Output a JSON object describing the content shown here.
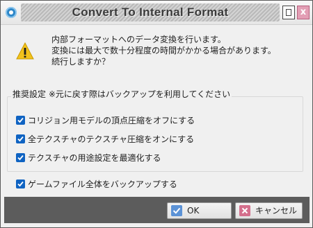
{
  "window": {
    "title": "Convert To Internal Format",
    "close_glyph": "x"
  },
  "message": {
    "icon": "warning-icon",
    "lines": [
      "内部フォーマットへのデータ変換を行います。",
      "変換には最大で数十分程度の時間がかかる場合があります。",
      "続行しますか？"
    ]
  },
  "recommended": {
    "legend": "推奨設定 ※元に戻す際はバックアップを利用してください",
    "options": [
      {
        "label": "コリジョン用モデルの頂点圧縮をオフにする",
        "checked": true
      },
      {
        "label": "全テクスチャのテクスチャ圧縮をオンにする",
        "checked": true
      },
      {
        "label": "テクスチャの用途設定を最適化する",
        "checked": true
      }
    ]
  },
  "backup": {
    "label": "ゲームファイル全体をバックアップする",
    "checked": true
  },
  "buttons": {
    "ok": {
      "label": "OK",
      "icon": "check-icon"
    },
    "cancel": {
      "label": "キャンセル",
      "icon": "cross-icon"
    }
  },
  "colors": {
    "accent": "#0f63c2",
    "warning": "#f2c21b",
    "close_button": "#e39fb5",
    "footer": "#5c5c5c"
  }
}
